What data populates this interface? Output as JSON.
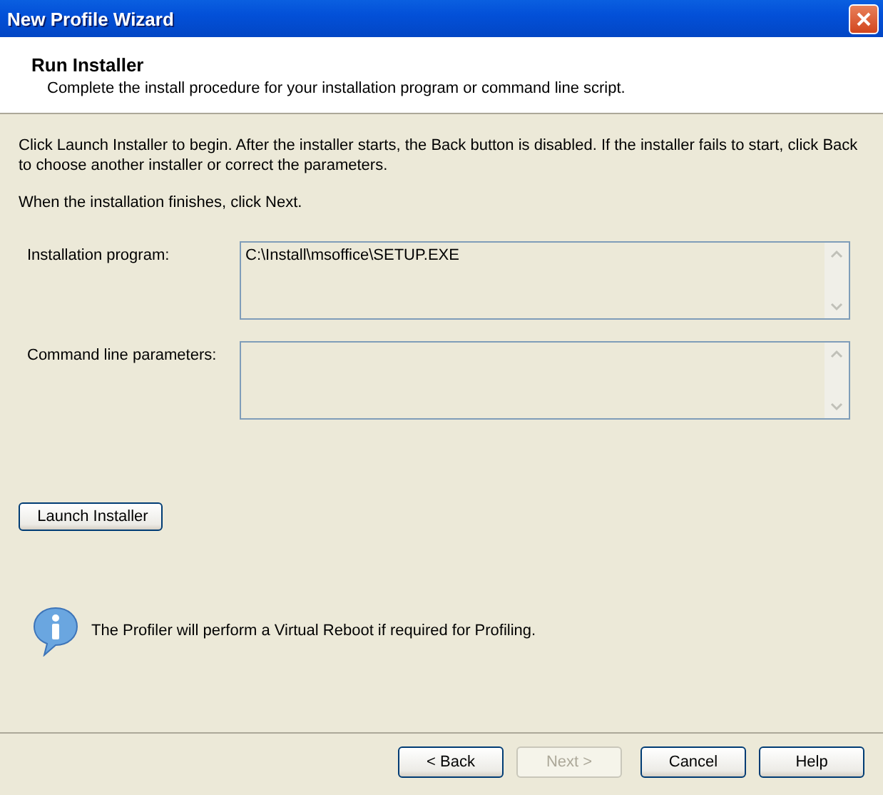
{
  "window": {
    "title": "New Profile Wizard"
  },
  "header": {
    "title": "Run Installer",
    "subtitle": "Complete the install procedure for your installation program or command line script."
  },
  "instructions": [
    "Click Launch Installer to begin. After the installer starts, the Back button is disabled. If the installer fails to start, click Back to choose another installer or correct the parameters.",
    "When the installation finishes, click Next."
  ],
  "fields": [
    {
      "label": "Installation program:",
      "value": "C:\\Install\\msoffice\\SETUP.EXE"
    },
    {
      "label": "Command line parameters:"
    }
  ],
  "launch_button": "Launch Installer",
  "info": "The Profiler will perform a Virtual Reboot if required for Profiling.",
  "buttons": [
    {
      "label": "< Back",
      "disabled": false
    },
    {
      "label": "Next >",
      "disabled": true
    },
    {
      "label": "Cancel",
      "disabled": false
    },
    {
      "label": "Help",
      "disabled": false
    }
  ]
}
